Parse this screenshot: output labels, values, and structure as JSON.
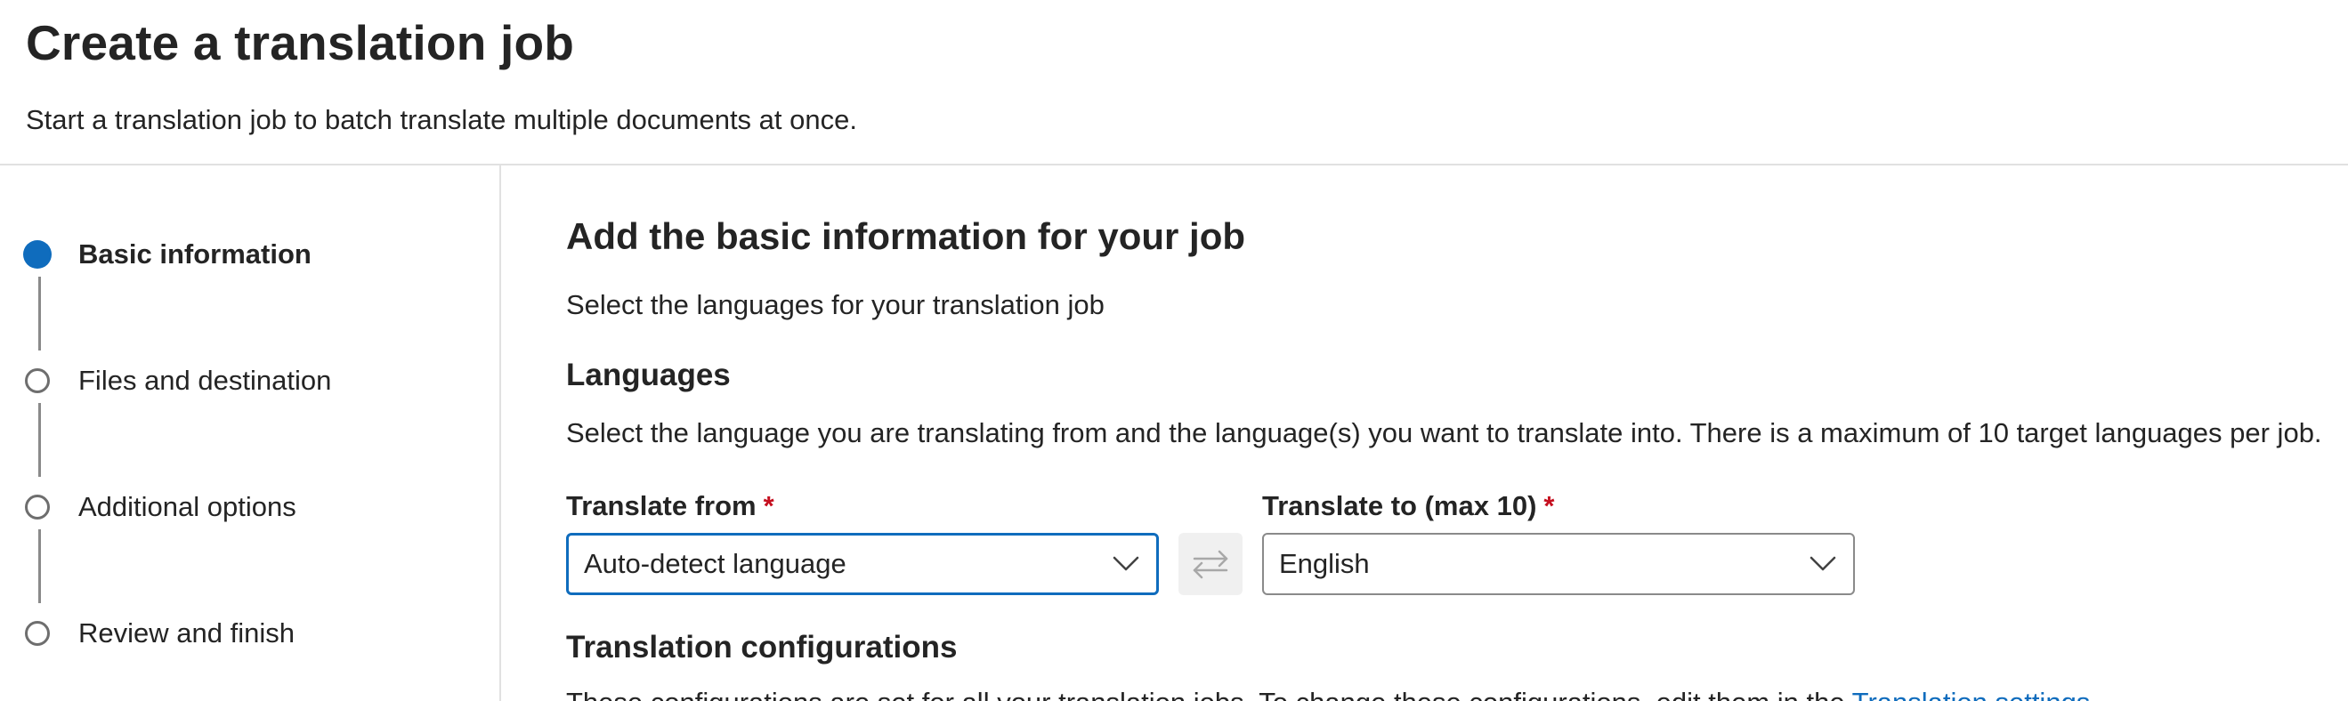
{
  "header": {
    "title": "Create a translation job",
    "subtitle": "Start a translation job to batch translate multiple documents at once."
  },
  "stepper": {
    "steps": [
      {
        "label": "Basic information",
        "state": "active"
      },
      {
        "label": "Files and destination",
        "state": "pending"
      },
      {
        "label": "Additional options",
        "state": "pending"
      },
      {
        "label": "Review and finish",
        "state": "pending"
      }
    ]
  },
  "main": {
    "section_title": "Add the basic information for your job",
    "section_desc": "Select the languages for your translation job",
    "languages": {
      "heading": "Languages",
      "description": "Select the language you are translating from and the language(s) you want to translate into. There is a maximum of 10 target languages per job.",
      "from": {
        "label": "Translate from",
        "required_mark": "*",
        "value": "Auto-detect language"
      },
      "to": {
        "label": "Translate to (max 10)",
        "required_mark": "*",
        "value": "English"
      },
      "swap_icon": "swap-arrows-icon"
    },
    "configurations": {
      "heading": "Translation configurations",
      "description": "These configurations are set for all your translation jobs. To change these configurations, edit them in the ",
      "link_text": "Translation settings",
      "link_suffix": "."
    }
  },
  "colors": {
    "accent": "#0f6cbd",
    "required": "#c50f1f",
    "divider": "#e1e1e1"
  }
}
